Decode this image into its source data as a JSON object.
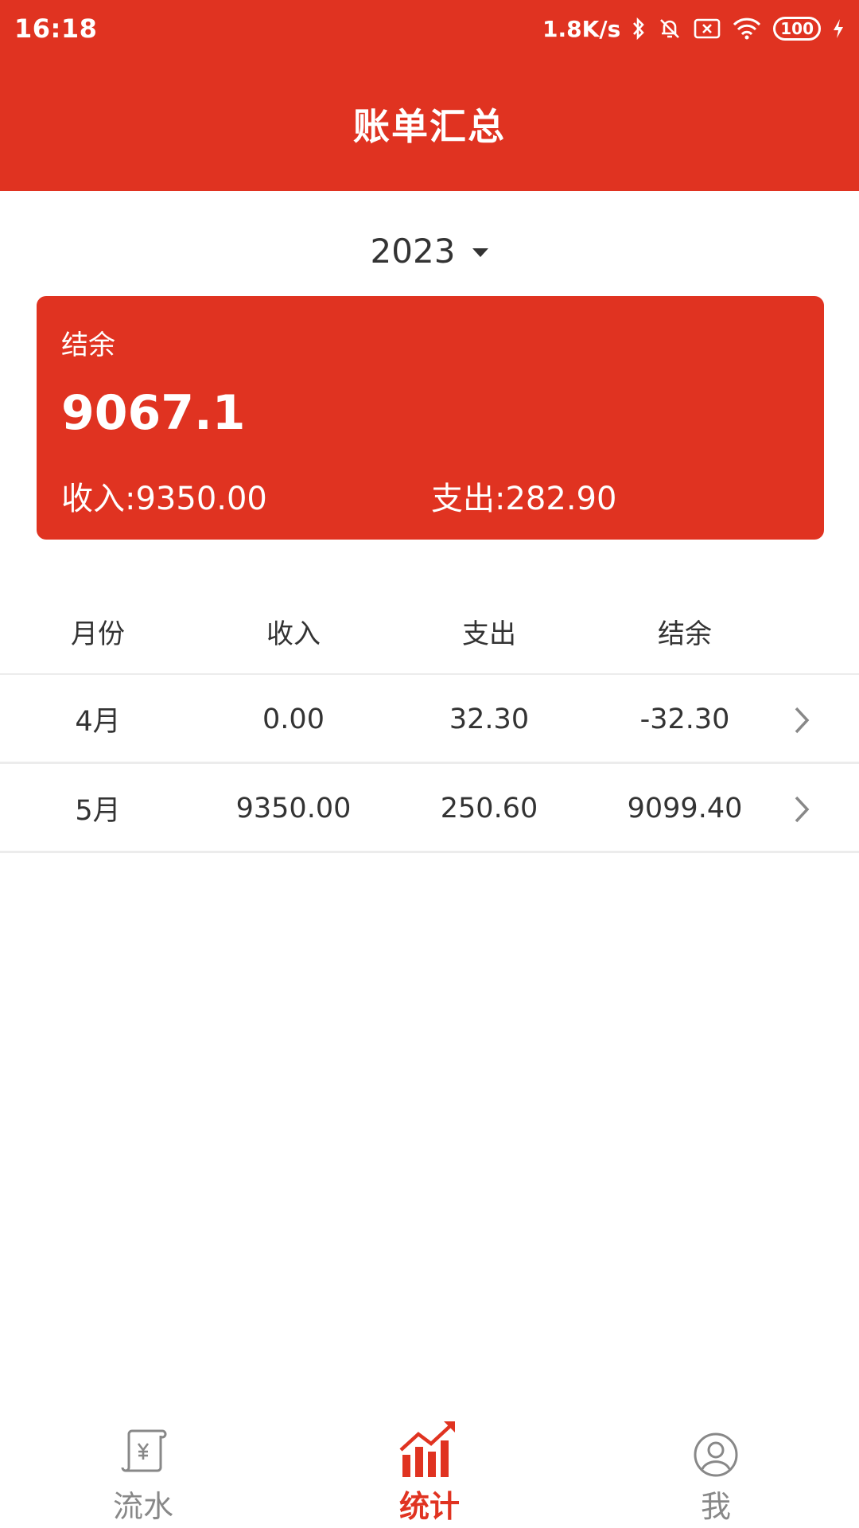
{
  "status_bar": {
    "time": "16:18",
    "net_speed": "1.8K/s",
    "battery": "100",
    "icons": [
      "bluetooth-icon",
      "mute-icon",
      "sim-none-icon",
      "wifi-icon",
      "battery-icon",
      "charging-icon"
    ]
  },
  "header": {
    "title": "账单汇总"
  },
  "year_selector": {
    "value": "2023"
  },
  "summary": {
    "label": "结余",
    "balance": "9067.1",
    "income": "收入:9350.00",
    "expense": "支出:282.90"
  },
  "table": {
    "headers": [
      "月份",
      "收入",
      "支出",
      "结余"
    ],
    "rows": [
      {
        "month": "4月",
        "income": "0.00",
        "expense": "32.30",
        "balance": "-32.30"
      },
      {
        "month": "5月",
        "income": "9350.00",
        "expense": "250.60",
        "balance": "9099.40"
      }
    ]
  },
  "tabbar": {
    "items": [
      {
        "label": "流水",
        "icon": "ledger-icon",
        "active": false
      },
      {
        "label": "统计",
        "icon": "chart-icon",
        "active": true
      },
      {
        "label": "我",
        "icon": "user-icon",
        "active": false
      }
    ]
  },
  "colors": {
    "accent": "#e03321",
    "inactive": "#888888"
  }
}
